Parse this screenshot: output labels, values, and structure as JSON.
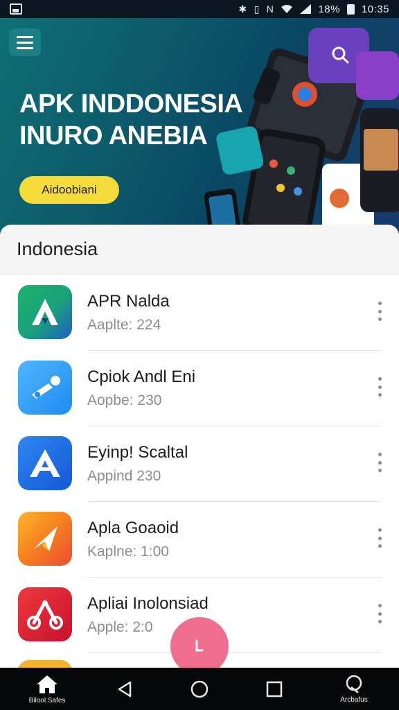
{
  "status_bar": {
    "icons": [
      "bluetooth-icon",
      "vibrate-icon",
      "nfc-icon",
      "wifi-icon",
      "signal-icon"
    ],
    "battery": "18%",
    "time": "10:35"
  },
  "hero": {
    "menu_icon": "hamburger-menu-icon",
    "title_line1": "APK INDDONESIA",
    "title_line2": "INURO  ANEBIA",
    "cta_label": "Aidoobiani",
    "search_icon": "search-icon",
    "accent_color": "#f6dc3a"
  },
  "section": {
    "title": "Indonesia"
  },
  "apps": [
    {
      "name": "APR Nalda",
      "meta": "Aaplte:  224",
      "icon": "app-icon-green-a"
    },
    {
      "name": "Cpiok Andl Eni",
      "meta": "Aopbe:  230",
      "icon": "app-icon-blue-wrench"
    },
    {
      "name": "Eyinp! Scaltal",
      "meta": "Appind  230",
      "icon": "app-icon-blue-a"
    },
    {
      "name": "Apla  Goaoid",
      "meta": "Kaplne:  1:00",
      "icon": "app-icon-orange-arrow"
    },
    {
      "name": "Apliai Inolonsiad",
      "meta": "Apple:  2:0",
      "icon": "app-icon-red-nodes"
    }
  ],
  "fab": {
    "icon": "fab-action-icon",
    "color": "#ef6d8e"
  },
  "bottom_nav": {
    "home_label": "Bilool Safes",
    "right_label": "Arcbafus",
    "icons": [
      "home-icon",
      "back-icon",
      "home-circle-icon",
      "recents-icon",
      "account-icon"
    ]
  }
}
